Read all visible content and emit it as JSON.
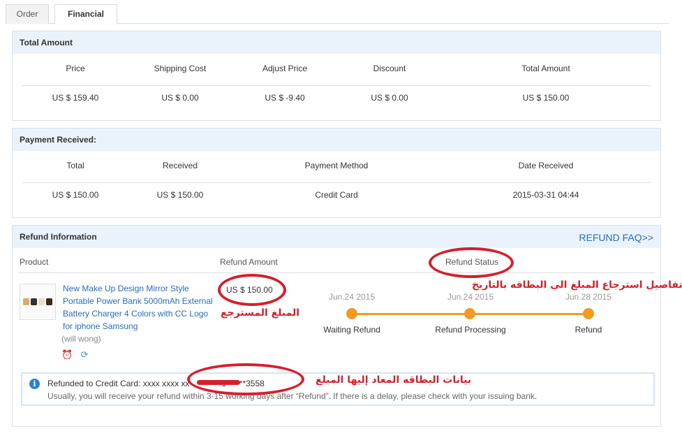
{
  "tabs": {
    "order": "Order",
    "financial": "Financial"
  },
  "total_amount": {
    "title": "Total Amount",
    "headers": [
      "Price",
      "Shipping Cost",
      "Adjust Price",
      "Discount",
      "Total Amount"
    ],
    "values": [
      "US $ 159.40",
      "US $ 0.00",
      "US $ -9.40",
      "US $ 0.00",
      "US $ 150.00"
    ]
  },
  "payment_received": {
    "title": "Payment Received:",
    "headers": [
      "Total",
      "Received",
      "Payment Method",
      "Date Received"
    ],
    "values": [
      "US $ 150.00",
      "US $ 150.00",
      "Credit Card",
      "2015-03-31 04:44"
    ]
  },
  "refund": {
    "title": "Refund Information",
    "faq_link": "REFUND FAQ>>",
    "col_product": "Product",
    "col_amount": "Refund Amount",
    "col_status": "Refund Status",
    "product_title": "New Make Up Design Mirror Style Portable Power Bank 5000mAh External Battery Charger 4 Colors with CC Logo for iphone Samsung",
    "product_user": "(will wong)",
    "amount": "US $ 150.00",
    "timeline": [
      {
        "date": "Jun.24 2015",
        "label": "Waiting Refund"
      },
      {
        "date": "Jun.24 2015",
        "label": "Refund Processing"
      },
      {
        "date": "Jun.28 2015",
        "label": "Refund"
      }
    ],
    "notice_label": "Refunded to Credit Card:",
    "notice_card": "xxxx xxxx xx",
    "notice_card_tail": "1******3558",
    "notice_text": "Usually, you will receive your refund within 3-15 working days after “Refund”. If there is a delay, please check with your issuing bank."
  },
  "annotations": {
    "status_details": "تفاصيل استرجاع المبلغ الى البطاقه بالتاريخ",
    "refunded_amount": "المبلغ المسترجع",
    "card_details": "بيانات البطاقه المعاد إليها المبلغ",
    "color": "#d4202c"
  },
  "colors": {
    "link": "#2a6db5",
    "timeline": "#f39a23",
    "panel_header": "#eaf2fb"
  }
}
